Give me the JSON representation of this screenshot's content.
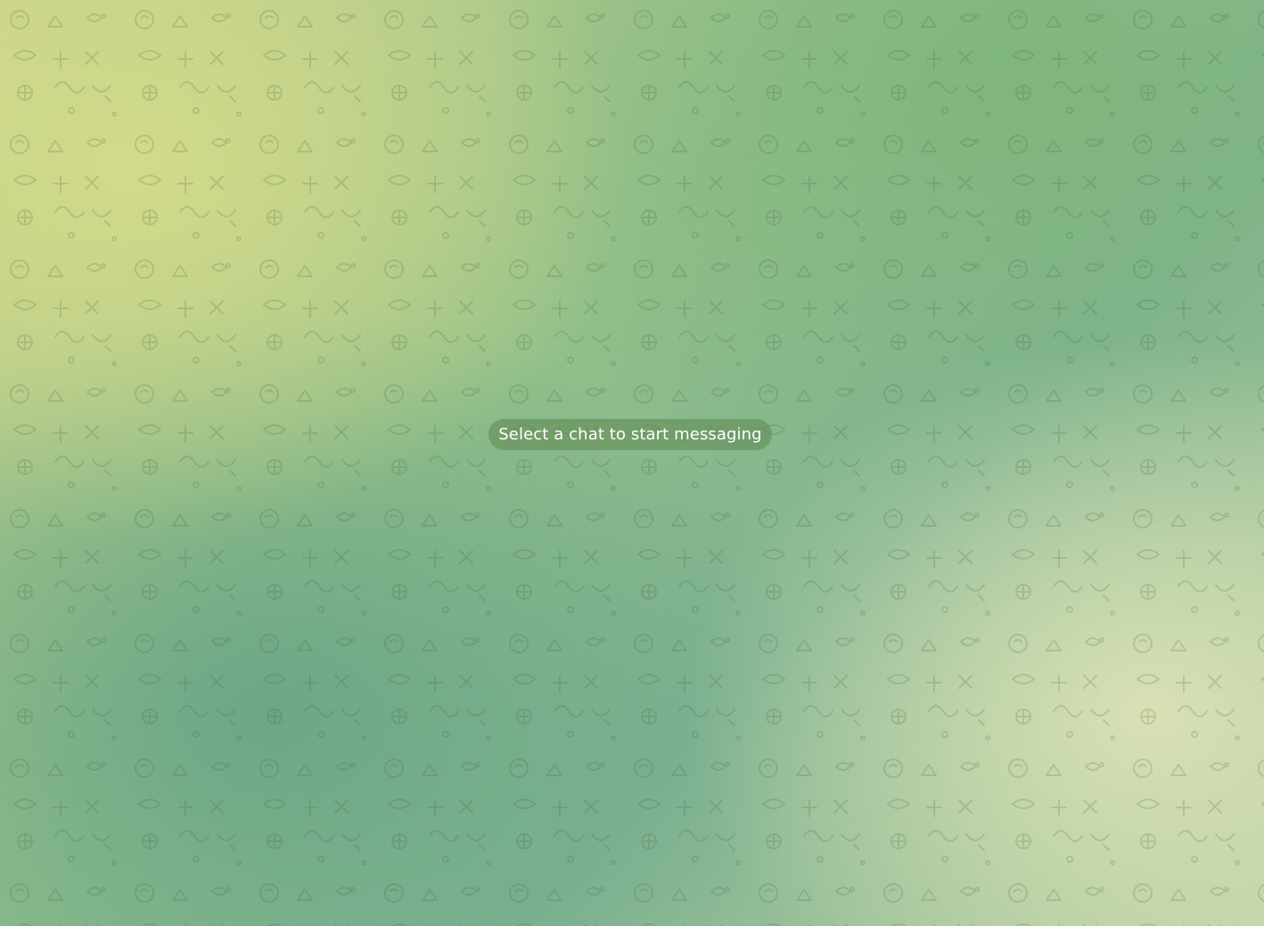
{
  "chat_area": {
    "background_colors": {
      "light_yellow": "#d4db8a",
      "mid_green": "#93c08a",
      "deep_green": "#68a486",
      "pale_cream": "#dce2b6"
    },
    "pattern_icon": "doodle-pattern",
    "placeholder_text": "Select a chat to start messaging",
    "placeholder_color": "#5e8750"
  }
}
